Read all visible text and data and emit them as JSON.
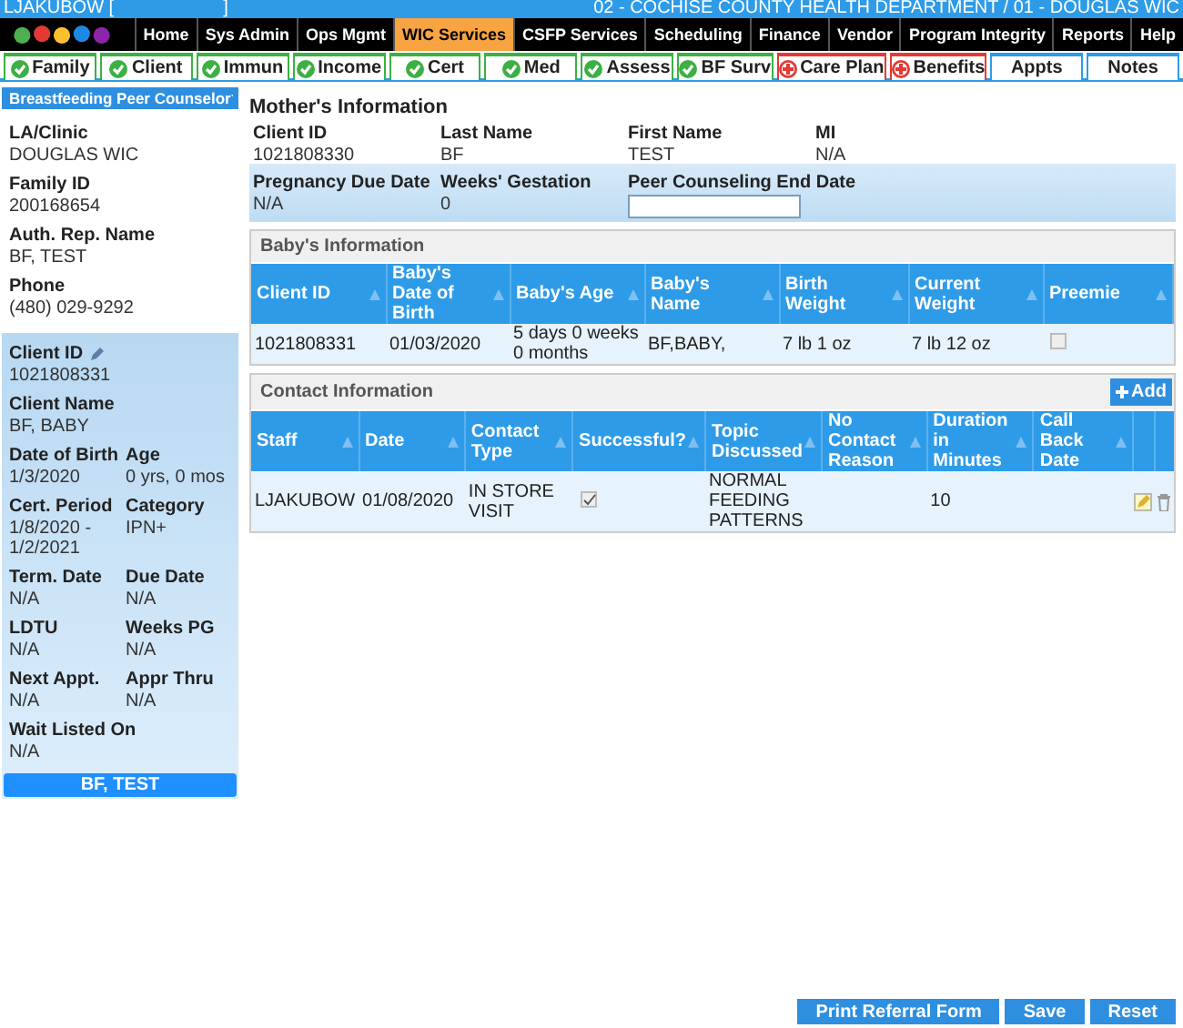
{
  "header": {
    "user": "LJAKUBOW [",
    "user_end": "]",
    "location": "02 - COCHISE COUNTY HEALTH DEPARTMENT / 01 - DOUGLAS WIC"
  },
  "menu": [
    {
      "label": "Home",
      "selected": false
    },
    {
      "label": "Sys Admin",
      "selected": false
    },
    {
      "label": "Ops Mgmt",
      "selected": false
    },
    {
      "label": "WIC Services",
      "selected": true
    },
    {
      "label": "CSFP Services",
      "selected": false
    },
    {
      "label": "Scheduling",
      "selected": false
    },
    {
      "label": "Finance",
      "selected": false
    },
    {
      "label": "Vendor",
      "selected": false
    },
    {
      "label": "Program Integrity",
      "selected": false
    },
    {
      "label": "Reports",
      "selected": false
    },
    {
      "label": "Help",
      "selected": false
    }
  ],
  "tabs": [
    {
      "label": "Family",
      "kind": "done"
    },
    {
      "label": "Client",
      "kind": "done"
    },
    {
      "label": "Immun",
      "kind": "done"
    },
    {
      "label": "Income",
      "kind": "done"
    },
    {
      "label": "Cert",
      "kind": "done"
    },
    {
      "label": "Med",
      "kind": "done"
    },
    {
      "label": "Assess",
      "kind": "done"
    },
    {
      "label": "BF Surv",
      "kind": "done"
    },
    {
      "label": "Care Plan",
      "kind": "alert"
    },
    {
      "label": "Benefits",
      "kind": "alert"
    },
    {
      "label": "Appts",
      "kind": "plain"
    },
    {
      "label": "Notes",
      "kind": "plain"
    }
  ],
  "sidebar": {
    "dropdown": "Breastfeeding Peer Counselor",
    "family_fields": [
      {
        "label": "LA/Clinic",
        "value": "DOUGLAS WIC"
      },
      {
        "label": "Family ID",
        "value": "200168654"
      },
      {
        "label": "Auth. Rep. Name",
        "value": "BF, TEST"
      },
      {
        "label": "Phone",
        "value": "(480) 029-9292"
      }
    ],
    "client_fields": [
      [
        {
          "label": "Client ID",
          "value": "1021808331",
          "editable": true
        }
      ],
      [
        {
          "label": "Client Name",
          "value": "BF, BABY"
        }
      ],
      [
        {
          "label": "Date of Birth",
          "value": "1/3/2020"
        },
        {
          "label": "Age",
          "value": "0 yrs, 0 mos"
        }
      ],
      [
        {
          "label": "Cert. Period",
          "value": "1/8/2020 - 1/2/2021"
        },
        {
          "label": "Category",
          "value": "IPN+"
        }
      ],
      [
        {
          "label": "Term. Date",
          "value": "N/A"
        },
        {
          "label": "Due Date",
          "value": "N/A"
        }
      ],
      [
        {
          "label": "LDTU",
          "value": "N/A"
        },
        {
          "label": "Weeks PG",
          "value": "N/A"
        }
      ],
      [
        {
          "label": "Next Appt.",
          "value": "N/A"
        },
        {
          "label": "Appr Thru",
          "value": "N/A"
        }
      ],
      [
        {
          "label": "Wait Listed On",
          "value": "N/A"
        }
      ]
    ],
    "family_button": "BF, TEST"
  },
  "mother": {
    "title": "Mother's Information",
    "fields": [
      {
        "label": "Client ID",
        "value": "1021808330"
      },
      {
        "label": "Last Name",
        "value": "BF"
      },
      {
        "label": "First Name",
        "value": "TEST"
      },
      {
        "label": "MI",
        "value": "N/A"
      }
    ],
    "fields2": [
      {
        "label": "Pregnancy Due Date",
        "value": "N/A"
      },
      {
        "label": "Weeks' Gestation",
        "value": "0"
      }
    ],
    "end_date": {
      "label": "Peer Counseling End Date"
    }
  },
  "baby_table": {
    "title": "Baby's Information",
    "columns": [
      "Client ID",
      "Baby's Date of Birth",
      "Baby's Age",
      "Baby's Name",
      "Birth Weight",
      "Current Weight",
      "Preemie"
    ],
    "rows": [
      {
        "cells": [
          "1021808331",
          "01/03/2020",
          "5 days 0 weeks 0 months",
          "BF,BABY,",
          "7 lb 1 oz",
          "7 lb 12 oz"
        ],
        "preemie": false
      }
    ]
  },
  "contact_table": {
    "title": "Contact Information",
    "add_button": "Add",
    "columns": [
      "Staff",
      "Date",
      "Contact Type",
      "Successful?",
      "Topic Discussed",
      "No Contact Reason",
      "Duration in Minutes",
      "Call Back Date"
    ],
    "rows": [
      {
        "staff": "LJAKUBOW",
        "date": "01/08/2020",
        "type": "IN STORE VISIT",
        "successful": true,
        "topic": "NORMAL FEEDING PATTERNS",
        "reason": "",
        "duration": "10",
        "callback": ""
      }
    ]
  },
  "buttons": [
    "Print Referral Form",
    "Save",
    "Reset"
  ]
}
